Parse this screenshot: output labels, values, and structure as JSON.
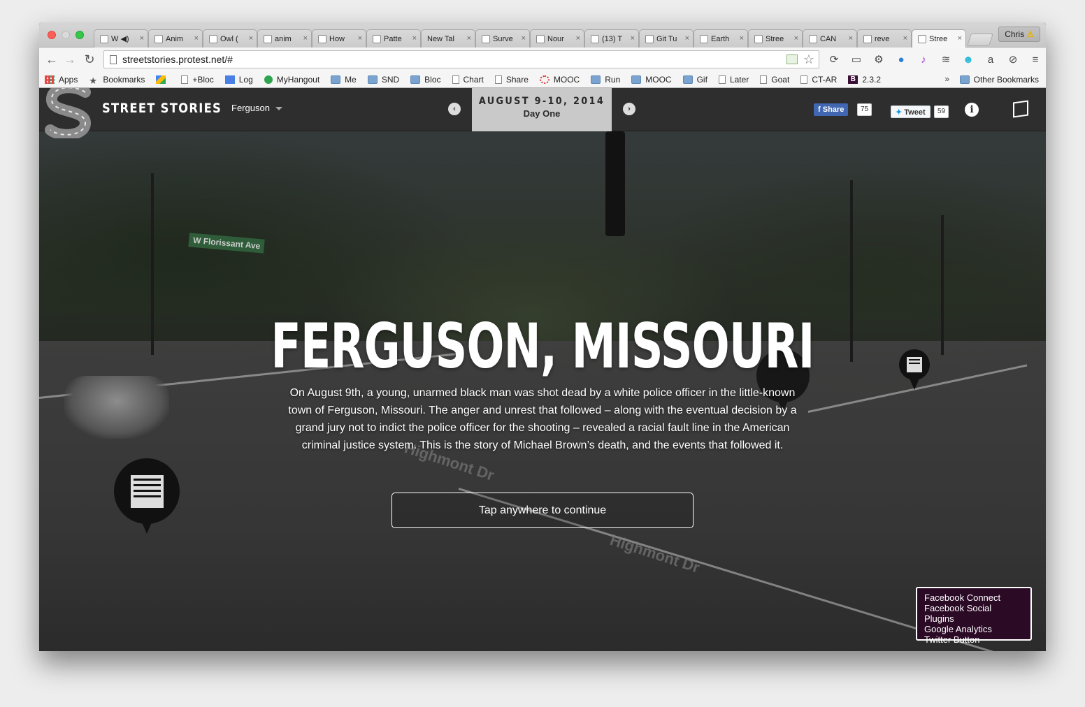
{
  "browser": {
    "tabs": [
      {
        "label": "W ◀)",
        "icon": "wikipedia-icon"
      },
      {
        "label": "Anim",
        "icon": "page-icon"
      },
      {
        "label": "Owl (",
        "icon": "owl-icon"
      },
      {
        "label": "anim",
        "icon": "page-icon"
      },
      {
        "label": "How",
        "icon": "tg-icon"
      },
      {
        "label": "Patte",
        "icon": "page-icon"
      },
      {
        "label": "New Tal",
        "icon": "none"
      },
      {
        "label": "Surve",
        "icon": "survey-icon"
      },
      {
        "label": "Nour",
        "icon": "nour-icon"
      },
      {
        "label": "(13) T",
        "icon": "pinterest-icon"
      },
      {
        "label": "Git Tu",
        "icon": "git-icon"
      },
      {
        "label": "Earth",
        "icon": "earth-icon"
      },
      {
        "label": "Stree",
        "icon": "circle-icon"
      },
      {
        "label": "CAN",
        "icon": "page-icon"
      },
      {
        "label": "reve",
        "icon": "page-icon"
      },
      {
        "label": "Stree",
        "icon": "page-icon"
      }
    ],
    "active_tab_index": 15,
    "profile": {
      "name": "Chris",
      "badge": "⚠"
    },
    "url": "streetstories.protest.net/#",
    "bookmarks": [
      "Apps",
      "Bookmarks",
      "",
      "+Bloc",
      "Log",
      "MyHangout",
      "Me",
      "SND",
      "Bloc",
      "Chart",
      "Share",
      "MOOC",
      "Run",
      "MOOC",
      "Gif",
      "Later",
      "Goat",
      "CT-AR",
      "2.3.2"
    ],
    "bookmarks_overflow": "»",
    "other_bookmarks": "Other Bookmarks",
    "b_badge": "B"
  },
  "site": {
    "brand": "STREET STORIES",
    "location": "Ferguson",
    "date": "AUGUST 9-10, 2014",
    "day": "Day One",
    "prev_label": "‹",
    "next_label": "›",
    "share_label": "Share",
    "share_count": "75",
    "tweet_label": "Tweet",
    "tweet_count": "59",
    "info_label": "i"
  },
  "hero": {
    "title": "FERGUSON, MISSOURI",
    "body": "On August 9th, a young, unarmed black man was shot dead by a white police officer in the little-known town of Ferguson, Missouri. The anger and unrest that followed – along with the eventual decision by a grand jury not to indict the police officer for the shooting – revealed a racial fault line in the American criminal justice system. This is the story of Michael Brown’s death, and the events that followed it.",
    "cta": "Tap anywhere to continue"
  },
  "scene_labels": {
    "street_sign": "W Florissant Ave",
    "road_1": "Highmont Dr",
    "road_2": "Highmont Dr"
  },
  "tracker": [
    "Facebook Connect",
    "Facebook Social Plugins",
    "Google Analytics",
    "Twitter Button"
  ]
}
